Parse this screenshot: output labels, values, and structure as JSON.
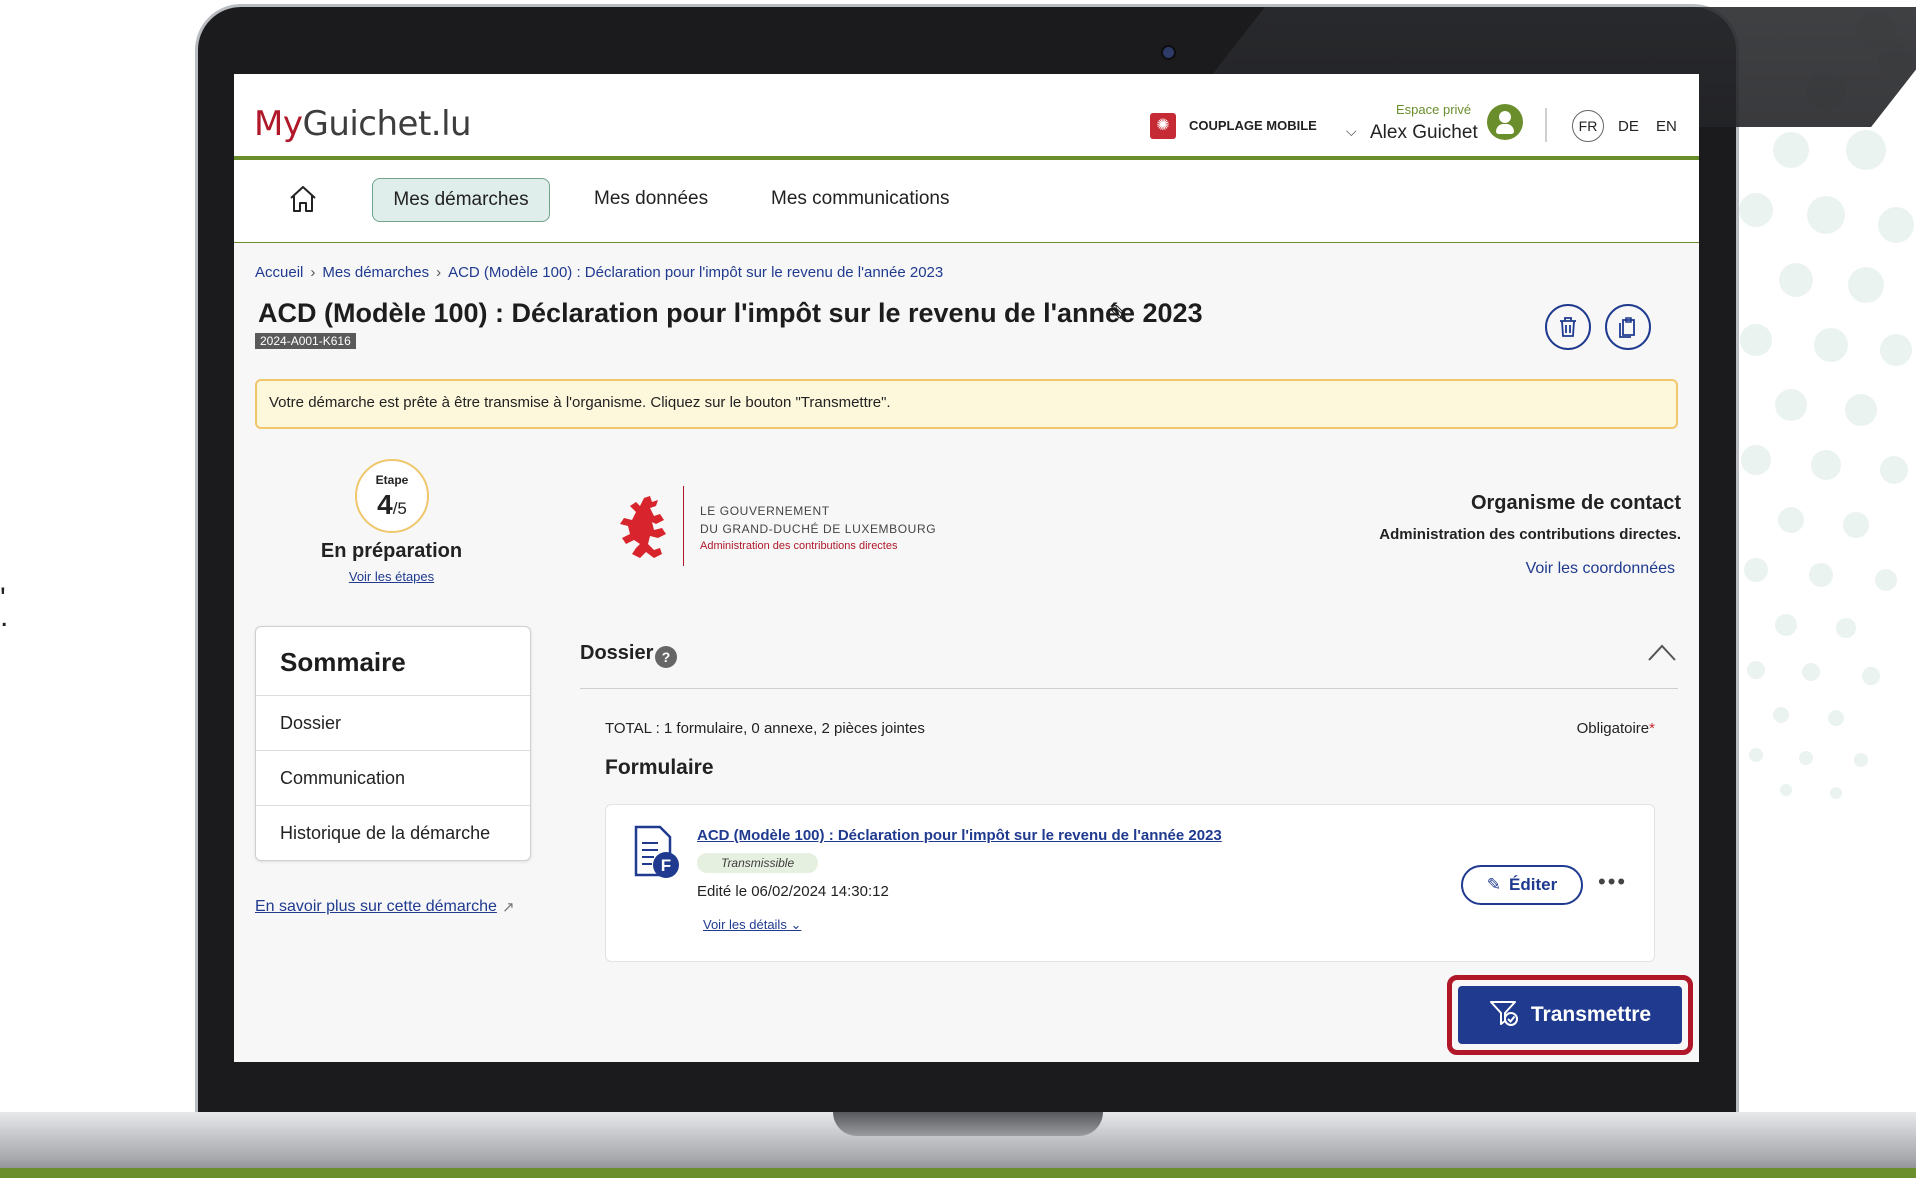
{
  "header": {
    "logo_my": "My",
    "logo_rest": "Guichet.lu",
    "couplage": "COUPLAGE MOBILE",
    "espace_prive": "Espace privé",
    "user_name": "Alex Guichet",
    "languages": [
      "FR",
      "DE",
      "EN"
    ]
  },
  "nav": {
    "items": [
      "Mes démarches",
      "Mes données",
      "Mes communications"
    ]
  },
  "breadcrumb": [
    "Accueil",
    "Mes démarches",
    "ACD (Modèle 100) : Déclaration pour l'impôt sur le revenu de l'année 2023"
  ],
  "page": {
    "title": "ACD (Modèle 100) : Déclaration pour l'impôt sur le revenu de l'année 2023",
    "reference": "2024-A001-K616",
    "alert": "Votre démarche est prête à être transmise à l'organisme. Cliquez sur le bouton \"Transmettre\"."
  },
  "progress": {
    "label": "Etape",
    "current": "4",
    "total": "/5",
    "status": "En préparation",
    "link": "Voir les étapes"
  },
  "government": {
    "line1": "LE GOUVERNEMENT",
    "line2": "DU GRAND-DUCHÉ DE LUXEMBOURG",
    "line3": "Administration des contributions directes"
  },
  "contact": {
    "title": "Organisme de contact",
    "name": "Administration des contributions directes.",
    "link": "Voir les coordonnées"
  },
  "summary": {
    "title": "Sommaire",
    "items": [
      "Dossier",
      "Communication",
      "Historique de la démarche"
    ],
    "more_link": "En savoir plus sur cette démarche"
  },
  "dossier": {
    "title": "Dossier",
    "help": "?",
    "total": "TOTAL : 1 formulaire, 0 annexe, 2 pièces jointes",
    "obligatoire": "Obligatoire",
    "obligatoire_star": "*",
    "formulaire_heading": "Formulaire",
    "form": {
      "link": "ACD (Modèle 100) : Déclaration pour l'impôt sur le revenu de l'année 2023",
      "badge": "Transmissible",
      "edited": "Edité le 06/02/2024 14:30:12",
      "details": "Voir les détails",
      "edit_button": "Éditer",
      "more": "•••"
    }
  },
  "actions": {
    "transmettre": "Transmettre"
  },
  "colors": {
    "brand_red": "#b0182a",
    "brand_green": "#6b8e2d",
    "link_blue": "#1f3a8f"
  }
}
